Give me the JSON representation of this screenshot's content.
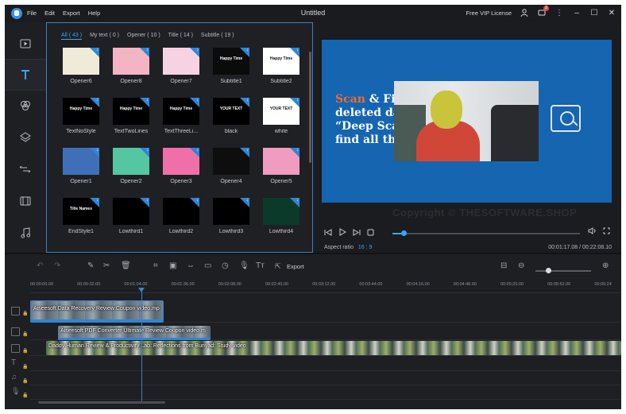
{
  "window": {
    "title": "Untitled",
    "menu": [
      "File",
      "Edit",
      "Export",
      "Help"
    ],
    "license": "Free VIP License",
    "notification_count": "2"
  },
  "rail": {
    "items": [
      "media",
      "text",
      "filters",
      "overlays",
      "transitions",
      "elements",
      "music"
    ],
    "active": "text"
  },
  "assets": {
    "tabs": [
      "All ( 43 )",
      "My text ( 0 )",
      "Opener ( 10 )",
      "Title ( 14 )",
      "Subtitle ( 19 )"
    ],
    "active_tab": "All ( 43 )",
    "items": [
      {
        "label": "Opener6",
        "bg": "#f0ead9",
        "caption": ""
      },
      {
        "label": "Opener8",
        "bg": "#f3b4c3",
        "caption": ""
      },
      {
        "label": "Opener7",
        "bg": "#f6d3e3",
        "caption": ""
      },
      {
        "label": "Subtitle1",
        "bg": "#0b0b0b",
        "caption": "Happy Time"
      },
      {
        "label": "Subtitle2",
        "bg": "#ffffff",
        "caption": "Happy Time"
      },
      {
        "label": "TextNoStyle",
        "bg": "#000000",
        "caption": "Happy Time"
      },
      {
        "label": "TextTwoLines",
        "bg": "#000000",
        "caption": "Happy Time"
      },
      {
        "label": "TextThreeLi...",
        "bg": "#000000",
        "caption": "Happy Time"
      },
      {
        "label": "black",
        "bg": "#000000",
        "caption": "YOUR TEXT"
      },
      {
        "label": "white",
        "bg": "#ffffff",
        "caption": "YOUR TEXT"
      },
      {
        "label": "Opener1",
        "bg": "#3f6fb8",
        "caption": ""
      },
      {
        "label": "Opener2",
        "bg": "#55c6a2",
        "caption": ""
      },
      {
        "label": "Opener3",
        "bg": "#ef6fa8",
        "caption": ""
      },
      {
        "label": "Opener4",
        "bg": "#0e0e0e",
        "caption": ""
      },
      {
        "label": "Opener5",
        "bg": "#f09cc0",
        "caption": ""
      },
      {
        "label": "EndStyle1",
        "bg": "#000000",
        "caption": "Title Names"
      },
      {
        "label": "Lowthird1",
        "bg": "#000000",
        "caption": ""
      },
      {
        "label": "Lowthird2",
        "bg": "#000000",
        "caption": ""
      },
      {
        "label": "Lowthird3",
        "bg": "#000000",
        "caption": ""
      },
      {
        "label": "Lowthird4",
        "bg": "#0c3a2a",
        "caption": ""
      }
    ]
  },
  "preview": {
    "headline_line1_accent": "Scan",
    "headline_line1_rest": " & Fi",
    "headline_line2": "deleted da",
    "headline_line3": "“Deep Sca",
    "headline_line4": "find all th",
    "watermark": "Copyright © THESOFTWARE.SHOP",
    "aspect_label": "Aspect ratio",
    "aspect_value": "16 : 9",
    "timecode": "00:01:17.08 / 00:22:08.10",
    "playback_fraction": 0.06
  },
  "toolbar": {
    "export_label": "Export",
    "zoom_fraction": 0.18
  },
  "timeline": {
    "ticks": [
      "00:00:00.00",
      "00:00:32.00",
      "00:01:04.00",
      "00:01:36.00",
      "00:02:08.00",
      "00:02:40.00",
      "00:03:12.00",
      "00:03:44.00",
      "00:04:16.00",
      "00:04:48.00",
      "00:05:20.00",
      "00:05:52.00",
      "00:06:24"
    ],
    "clips": [
      {
        "title": "Aiseesoft Data Recovery Review Coupon video.mp",
        "track": 0
      },
      {
        "title": "Aiseesoft PDF Converter Ultimate Review Coupon video.m",
        "track": 1
      },
      {
        "title": "Daddy Human Review & Productivity Lab: Reflections from Bunyad: Study video",
        "track": 2
      }
    ]
  },
  "colors": {
    "accent": "#3aa6f0",
    "canvas_bg": "#1565b0",
    "headline_accent": "#f26a2d"
  }
}
